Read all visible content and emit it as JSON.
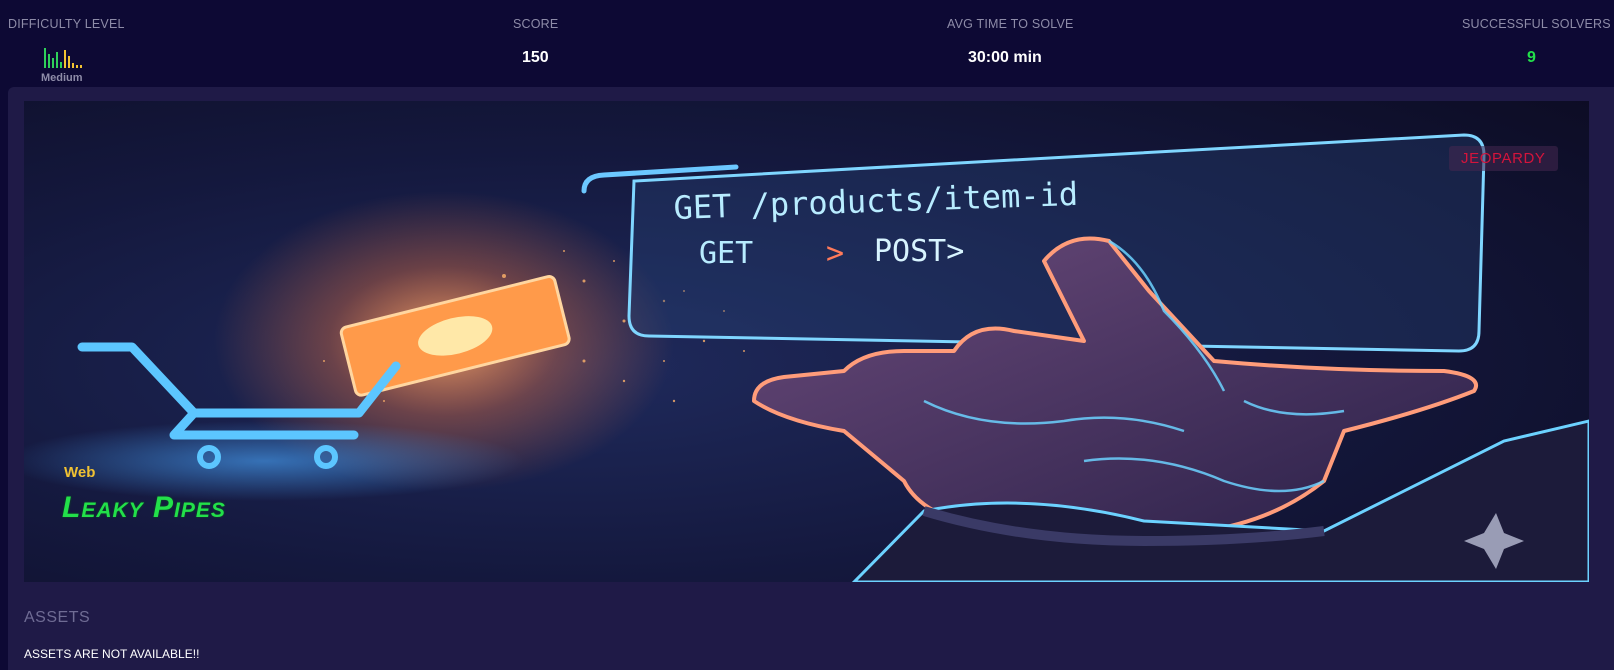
{
  "stats": {
    "difficulty": {
      "label": "DIFFICULTY LEVEL",
      "value": "Medium"
    },
    "score": {
      "label": "SCORE",
      "value": "150"
    },
    "avg_time": {
      "label": "AVG TIME TO SOLVE",
      "value": "30:00 min"
    },
    "solvers": {
      "label": "SUCCESSFUL SOLVERS",
      "value": "9"
    }
  },
  "banner": {
    "badge": "JEOPARDY",
    "category": "Web",
    "title": "Leaky Pipes",
    "screen_line1": "GET /products/item-id",
    "screen_line2_get": "GET",
    "screen_line2_arrow": ">",
    "screen_line2_post": "POST>"
  },
  "assets": {
    "heading": "ASSETS",
    "message": "ASSETS ARE NOT AVAILABLE!!"
  },
  "colors": {
    "background": "#0d0934",
    "panel": "#1f1a47",
    "title_green": "#22e04a",
    "category_yellow": "#f1c232",
    "badge_red": "#d4143c",
    "solvers_green": "#22e04a"
  }
}
